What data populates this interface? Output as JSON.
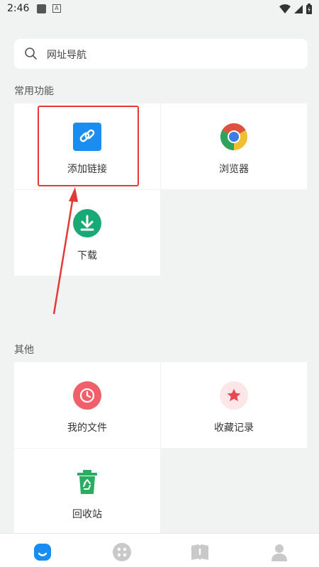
{
  "status": {
    "time": "2:46"
  },
  "search": {
    "placeholder": "网址导航"
  },
  "sections": {
    "common_title": "常用功能",
    "other_title": "其他"
  },
  "common_items": [
    {
      "label": "添加链接",
      "icon": "link-icon"
    },
    {
      "label": "浏览器",
      "icon": "chrome-icon"
    },
    {
      "label": "下载",
      "icon": "download-icon"
    }
  ],
  "other_items": [
    {
      "label": "我的文件",
      "icon": "clock-icon"
    },
    {
      "label": "收藏记录",
      "icon": "star-icon"
    },
    {
      "label": "回收站",
      "icon": "recycle-bin-icon"
    }
  ],
  "bottom_nav": [
    {
      "icon": "home-icon",
      "active": true
    },
    {
      "icon": "apps-icon",
      "active": false
    },
    {
      "icon": "book-icon",
      "active": false
    },
    {
      "icon": "profile-icon",
      "active": false
    }
  ],
  "colors": {
    "accent": "#1a8ef0",
    "highlight": "#e53935",
    "download_green": "#19a974",
    "recycle_green": "#27ae60",
    "file_red": "#f0606a",
    "star_red": "#e84855"
  }
}
